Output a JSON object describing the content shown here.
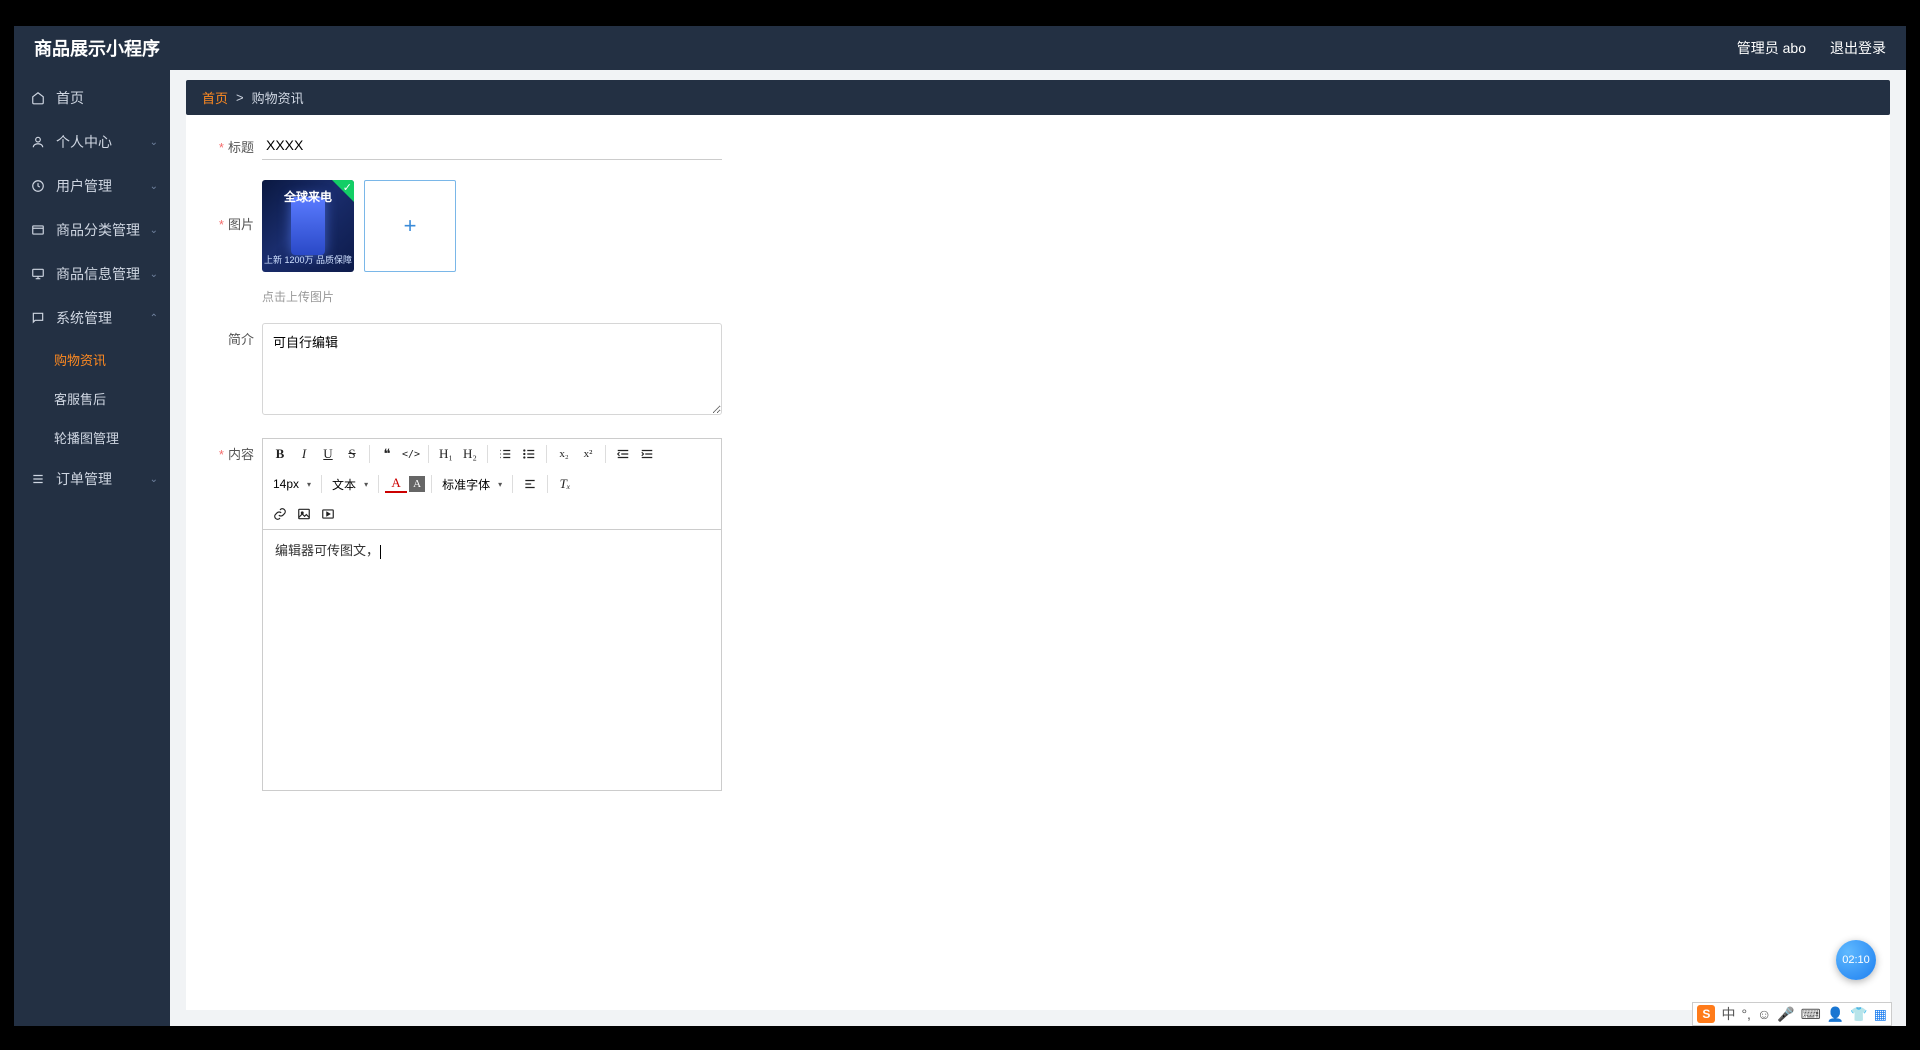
{
  "header": {
    "brand": "商品展示小程序",
    "admin_label": "管理员 abo",
    "logout_label": "退出登录"
  },
  "sidebar": {
    "items": [
      {
        "label": "首页",
        "icon": "home"
      },
      {
        "label": "个人中心",
        "icon": "user",
        "expandable": true
      },
      {
        "label": "用户管理",
        "icon": "clock",
        "expandable": true
      },
      {
        "label": "商品分类管理",
        "icon": "tabs",
        "expandable": true
      },
      {
        "label": "商品信息管理",
        "icon": "monitor",
        "expandable": true
      },
      {
        "label": "系统管理",
        "icon": "chat",
        "expandable": true,
        "expanded": true,
        "children": [
          {
            "label": "购物资讯",
            "active": true
          },
          {
            "label": "客服售后"
          },
          {
            "label": "轮播图管理"
          }
        ]
      },
      {
        "label": "订单管理",
        "icon": "list",
        "expandable": true
      }
    ]
  },
  "breadcrumb": {
    "home": "首页",
    "sep": ">",
    "current": "购物资讯"
  },
  "form": {
    "title_label": "标题",
    "title_value": "XXXX",
    "image_label": "图片",
    "thumb_caption": "全球来电",
    "thumb_sub": "上新 1200万 品质保障",
    "upload_plus": "+",
    "upload_hint": "点击上传图片",
    "intro_label": "简介",
    "intro_value": "可自行编辑",
    "content_label": "内容",
    "editor_text": "编辑器可传图文，"
  },
  "editor_toolbar": {
    "bold": "B",
    "italic": "I",
    "underline": "U",
    "strike": "S",
    "quote": "❝",
    "code": "</>",
    "h1": "H₁",
    "h2": "H₂",
    "ol": "≡",
    "ul": "≡",
    "sub": "x₂",
    "sup": "x²",
    "outdent": "⇤",
    "indent": "⇥",
    "size_sel": "14px",
    "style_sel": "文本",
    "font_sel": "标准字体",
    "color": "A",
    "bg": "A",
    "align": "≡",
    "clear": "Tₓ",
    "link": "🔗",
    "image": "🖼",
    "video": "▣"
  },
  "timer": "02:10",
  "ime": {
    "s": "S",
    "zh": "中",
    "punct": "°,",
    "emoji": "☺",
    "mic": "🎤",
    "kb": "⌨",
    "person": "👤",
    "shirt": "👕",
    "grid": "▦"
  }
}
